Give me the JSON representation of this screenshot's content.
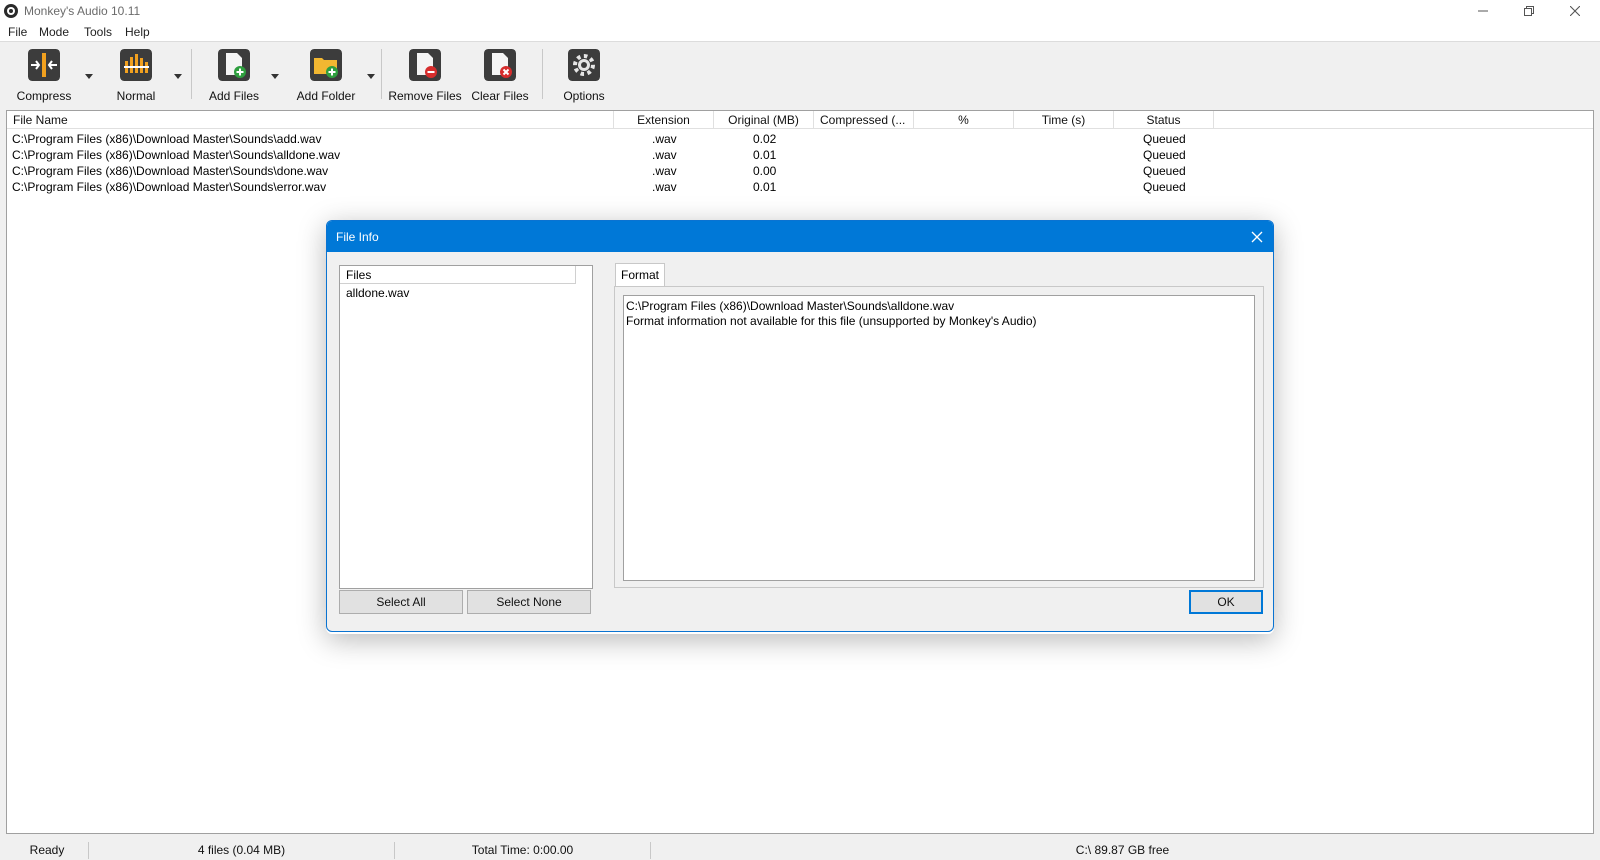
{
  "window": {
    "title": "Monkey's Audio 10.11"
  },
  "menu": [
    "File",
    "Mode",
    "Tools",
    "Help"
  ],
  "toolbar": {
    "compress": "Compress",
    "normal": "Normal",
    "add_files": "Add Files",
    "add_folder": "Add Folder",
    "remove_files": "Remove Files",
    "clear_files": "Clear Files",
    "options": "Options"
  },
  "list": {
    "columns": [
      "File Name",
      "Extension",
      "Original (MB)",
      "Compressed (...",
      "%",
      "Time (s)",
      "Status"
    ],
    "rows": [
      {
        "file": "C:\\Program Files (x86)\\Download Master\\Sounds\\add.wav",
        "ext": ".wav",
        "orig": "0.02",
        "status": "Queued"
      },
      {
        "file": "C:\\Program Files (x86)\\Download Master\\Sounds\\alldone.wav",
        "ext": ".wav",
        "orig": "0.01",
        "status": "Queued"
      },
      {
        "file": "C:\\Program Files (x86)\\Download Master\\Sounds\\done.wav",
        "ext": ".wav",
        "orig": "0.00",
        "status": "Queued"
      },
      {
        "file": "C:\\Program Files (x86)\\Download Master\\Sounds\\error.wav",
        "ext": ".wav",
        "orig": "0.01",
        "status": "Queued"
      }
    ]
  },
  "dialog": {
    "title": "File Info",
    "files_header": "Files",
    "files": [
      "alldone.wav"
    ],
    "tab": "Format",
    "info_lines": [
      "C:\\Program Files (x86)\\Download Master\\Sounds\\alldone.wav",
      "Format information not available for this file (unsupported by Monkey's Audio)"
    ],
    "select_all": "Select All",
    "select_none": "Select None",
    "ok": "OK"
  },
  "status": {
    "ready": "Ready",
    "files": "4 files (0.04 MB)",
    "total_time": "Total Time: 0:00.00",
    "free": "C:\\ 89.87 GB free"
  },
  "colors": {
    "accent": "#0078d7",
    "background": "#f0f0f0"
  },
  "icons": [
    "app-icon",
    "minimize-icon",
    "maximize-icon",
    "close-icon",
    "compress-icon",
    "normal-icon",
    "add-files-icon",
    "add-folder-icon",
    "remove-files-icon",
    "clear-files-icon",
    "options-icon",
    "dropdown-icon"
  ]
}
